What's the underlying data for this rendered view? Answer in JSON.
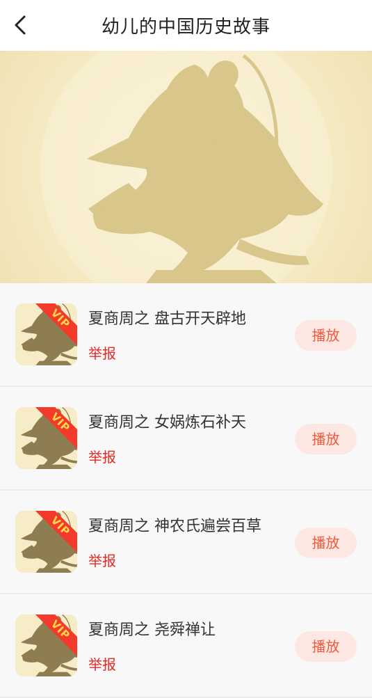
{
  "header": {
    "title": "幼儿的中国历史故事"
  },
  "banner": {
    "icon": "horse-archer-statue"
  },
  "list": {
    "vip_label": "VIP",
    "report_label": "举报",
    "play_label": "播放",
    "items": [
      {
        "title": "夏商周之 盘古开天辟地"
      },
      {
        "title": "夏商周之 女娲炼石补天"
      },
      {
        "title": "夏商周之 神农氏遍尝百草"
      },
      {
        "title": "夏商周之 尧舜禅让"
      }
    ]
  },
  "colors": {
    "accent": "#f05a3c",
    "report": "#e12a24",
    "vip_ribbon": "#f23b2a",
    "vip_text": "#ffd84a",
    "banner_bg": "#f7ecc8",
    "statue": "#d9c68a"
  }
}
